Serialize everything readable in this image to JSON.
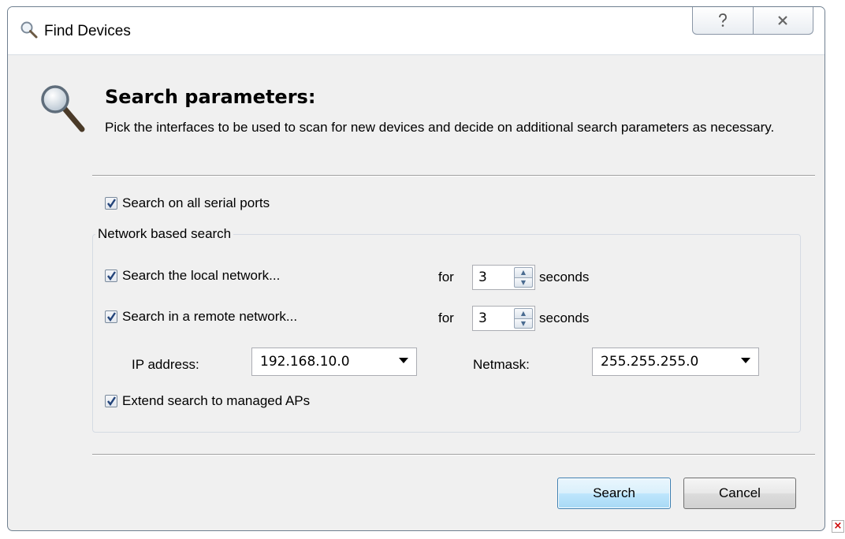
{
  "window": {
    "title": "Find Devices",
    "help_icon": "help-icon",
    "close_icon": "close-icon",
    "accent": "#3c7fb1"
  },
  "header": {
    "heading": "Search parameters:",
    "description": "Pick the interfaces to be used to scan for new devices and decide on additional search parameters as necessary.",
    "icon": "magnifier-icon"
  },
  "options": {
    "serial_ports": {
      "label": "Search on all serial ports",
      "checked": true
    },
    "network_group_label": "Network based search",
    "local_network": {
      "label": "Search the local network...",
      "for_label": "for",
      "value": "3",
      "unit": "seconds",
      "checked": true
    },
    "remote_network": {
      "label": "Search in a remote network...",
      "for_label": "for",
      "value": "3",
      "unit": "seconds",
      "checked": true
    },
    "ip_address": {
      "label": "IP address:",
      "value": "192.168.10.0"
    },
    "netmask": {
      "label": "Netmask:",
      "value": "255.255.255.0"
    },
    "managed_aps": {
      "label": "Extend search to managed APs",
      "checked": true
    }
  },
  "buttons": {
    "search": "Search",
    "cancel": "Cancel"
  }
}
